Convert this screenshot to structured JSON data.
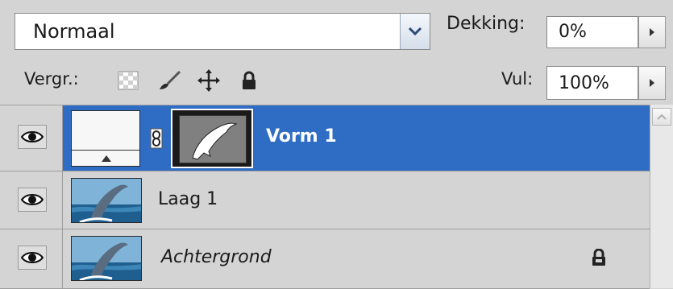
{
  "blend": {
    "mode": "Normaal"
  },
  "opacity": {
    "label": "Dekking:",
    "value": "0%"
  },
  "lock": {
    "label": "Vergr.:"
  },
  "fill": {
    "label": "Vul:",
    "value": "100%"
  },
  "colors": {
    "selection": "#2f6dc4",
    "panel": "#d4d4d4"
  },
  "layers": [
    {
      "name": "Vorm 1",
      "selected": true,
      "italic": false,
      "locked": false,
      "thumbnail": "white-fill",
      "mask": "dolphin-vector-mask"
    },
    {
      "name": "Laag 1",
      "selected": false,
      "italic": false,
      "locked": false,
      "thumbnail": "dolphin-photo"
    },
    {
      "name": "Achtergrond",
      "selected": false,
      "italic": true,
      "locked": true,
      "thumbnail": "dolphin-photo"
    }
  ]
}
